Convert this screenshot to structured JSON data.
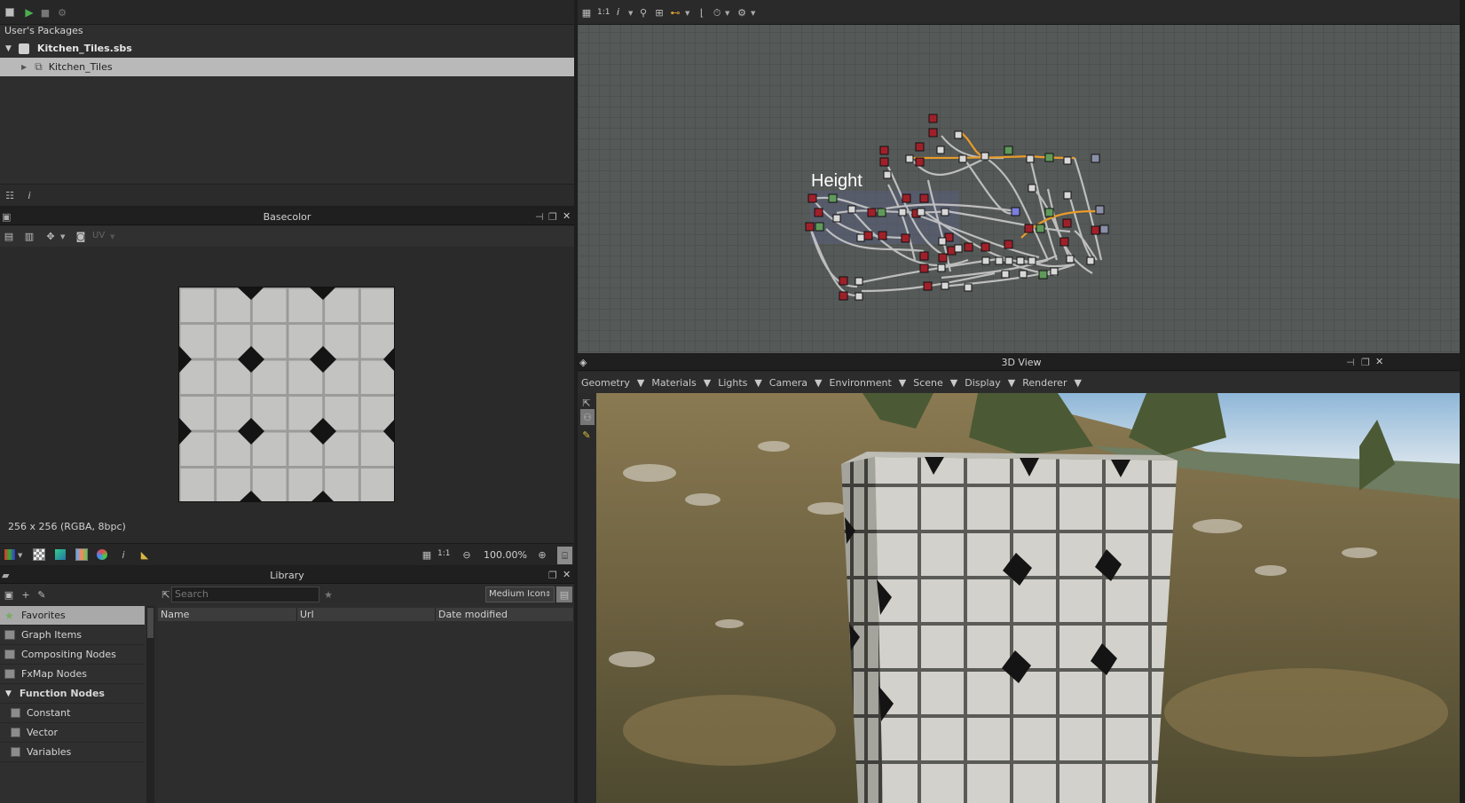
{
  "explorer": {
    "header": "User's Packages",
    "package": "Kitchen_Tiles.sbs",
    "graph_item": "Kitchen_Tiles",
    "footer_info_icon": "i"
  },
  "view2d": {
    "title": "Basecolor",
    "uv_label": "UV",
    "status": "256 x 256 (RGBA, 8bpc)",
    "ratio": "1:1",
    "zoom": "100.00%",
    "info_icon": "i"
  },
  "library": {
    "title": "Library",
    "search_placeholder": "Search",
    "view_mode": "Medium Icon",
    "columns": [
      "Name",
      "Url",
      "Date modified"
    ],
    "items": [
      {
        "label": "Favorites",
        "icon": "star-icon"
      },
      {
        "label": "Graph Items",
        "icon": "comment-icon"
      },
      {
        "label": "Compositing Nodes",
        "icon": "node-icon"
      },
      {
        "label": "FxMap Nodes",
        "icon": "grid-icon"
      },
      {
        "label": "Function Nodes",
        "icon": "expand-icon"
      },
      {
        "label": "Constant",
        "icon": "function-icon"
      },
      {
        "label": "Vector",
        "icon": "function-icon"
      },
      {
        "label": "Variables",
        "icon": "function-icon"
      }
    ]
  },
  "graph": {
    "frame_label": "Height",
    "ratio": "1:1",
    "info_icon": "i"
  },
  "view3d": {
    "title": "3D View",
    "menus": [
      "Geometry",
      "Materials",
      "Lights",
      "Camera",
      "Environment",
      "Scene",
      "Display",
      "Renderer"
    ]
  },
  "colors": {
    "accent_orange": "#e89b2a",
    "node_red": "#a0202a",
    "node_green": "#5f9a5a",
    "node_white": "#d8d8d8",
    "node_blue": "#7b7fe0",
    "panel_bg": "#2e2e2e",
    "selection": "#b9b9b9"
  }
}
